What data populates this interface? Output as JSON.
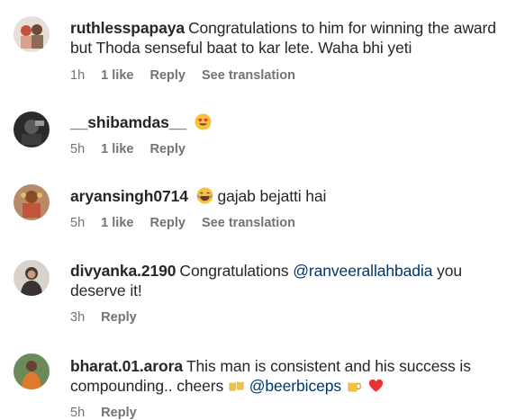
{
  "comments": [
    {
      "username": "ruthlesspapaya",
      "text": "Congratulations to him for winning the award but Thoda senseful baat to kar lete. Waha bhi yeti",
      "time": "1h",
      "likes": "1 like",
      "reply": "Reply",
      "translate": "See translation"
    },
    {
      "username": "__shibamdas__",
      "emoji": "heart-eyes-emoji",
      "time": "5h",
      "likes": "1 like",
      "reply": "Reply"
    },
    {
      "username": "aryansingh0714",
      "emoji": "laughing-emoji",
      "text": "gajab bejatti hai",
      "time": "5h",
      "likes": "1 like",
      "reply": "Reply",
      "translate": "See translation"
    },
    {
      "username": "divyanka.2190",
      "text_before": "Congratulations",
      "mention": "@ranveerallahbadia",
      "text_after": "you deserve it!",
      "time": "3h",
      "reply": "Reply"
    },
    {
      "username": "bharat.01.arora",
      "text_before": "This man is consistent and his success is compounding.. cheers",
      "mention": "@beerbiceps",
      "time": "5h",
      "reply": "Reply"
    }
  ],
  "colors": {
    "username": "#262626",
    "meta": "#737373",
    "mention": "#00376b"
  }
}
